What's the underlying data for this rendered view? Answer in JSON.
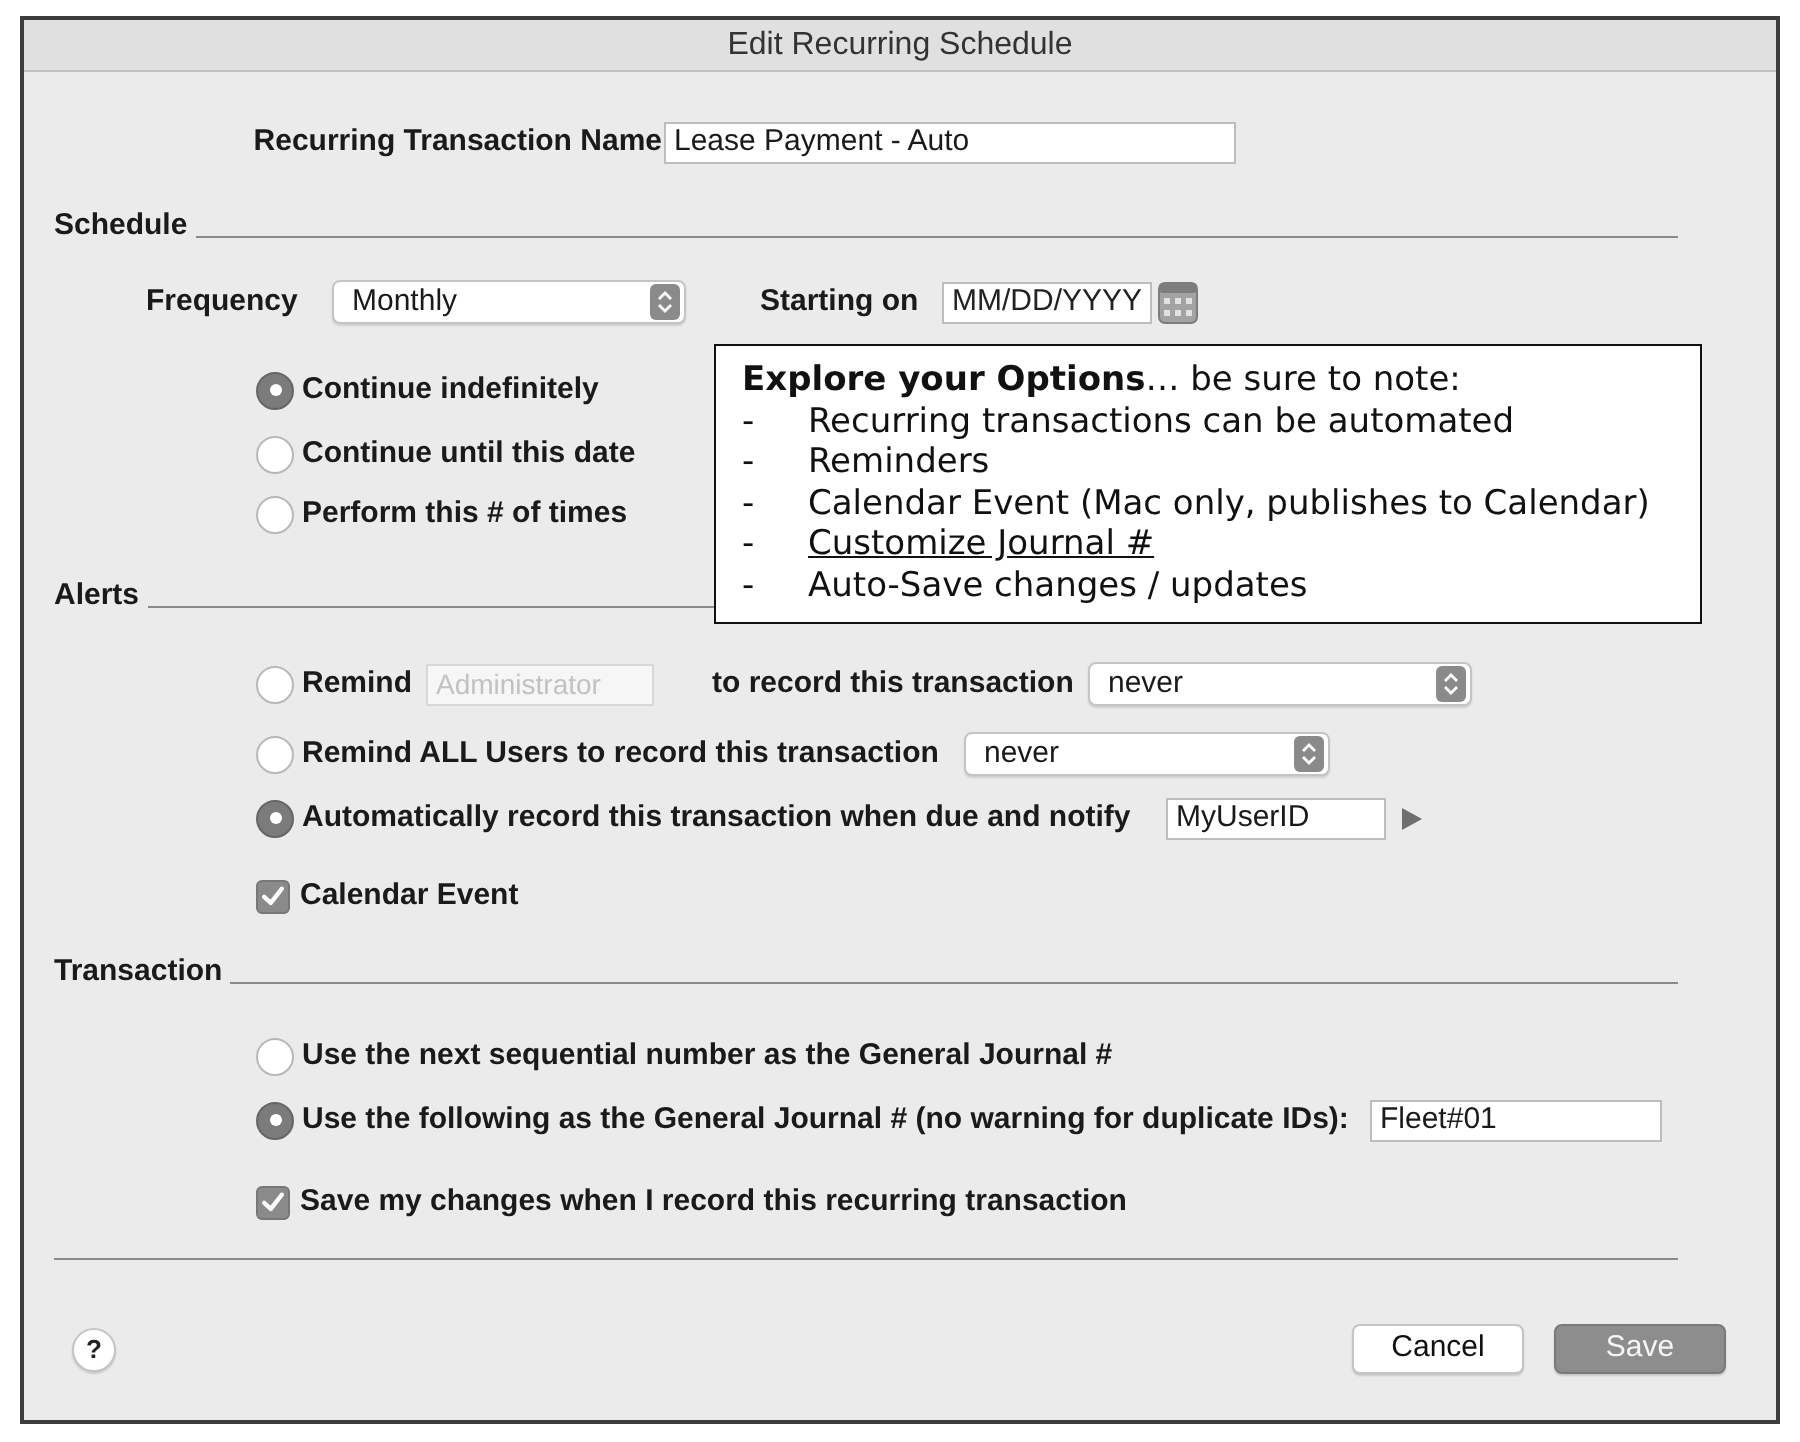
{
  "window": {
    "title": "Edit Recurring Schedule"
  },
  "name": {
    "label": "Recurring Transaction Name",
    "value": "Lease Payment - Auto"
  },
  "schedule": {
    "heading": "Schedule",
    "frequency": {
      "label": "Frequency",
      "value": "Monthly"
    },
    "starting_on": {
      "label": "Starting on",
      "placeholder": "MM/DD/YYYY"
    },
    "options": [
      {
        "label": "Continue indefinitely",
        "selected": true
      },
      {
        "label": "Continue until this date",
        "selected": false
      },
      {
        "label": "Perform this # of times",
        "selected": false
      }
    ]
  },
  "callout": {
    "heading": "**Explore your Options**… be sure to note:",
    "items": [
      {
        "marker": "-",
        "text": "Recurring transactions can be automated",
        "underlined": false
      },
      {
        "marker": "-",
        "text": "Reminders",
        "underlined": false
      },
      {
        "marker": "-",
        "text": "Calendar Event (Mac only, publishes to Calendar)",
        "underlined": false
      },
      {
        "marker": "-",
        "text": "Customize Journal #",
        "underlined": true
      },
      {
        "marker": "-",
        "text": "Auto-Save changes / updates",
        "underlined": false
      }
    ]
  },
  "alerts": {
    "heading": "Alerts",
    "options": [
      {
        "kind": "remind_user",
        "selected": false,
        "label": "Remind",
        "user": {
          "value": "Administrator",
          "disabled": true
        },
        "suffix": "to record this transaction",
        "when": "never"
      },
      {
        "kind": "remind_all",
        "selected": false,
        "label": "Remind ALL Users to record this transaction",
        "when": "never"
      },
      {
        "kind": "auto_record",
        "selected": true,
        "label": "Automatically record this transaction when due and notify",
        "notify": "MyUserID"
      }
    ],
    "calendar_event": {
      "label": "Calendar Event",
      "checked": true
    }
  },
  "transaction": {
    "heading": "Transaction",
    "options": [
      {
        "kind": "sequential",
        "selected": false,
        "label": "Use the next sequential number as the General Journal #"
      },
      {
        "kind": "custom",
        "selected": true,
        "label": "Use the following as the General Journal # (no warning for duplicate IDs):",
        "value": "Fleet#01"
      }
    ],
    "save_changes": {
      "label": "Save my changes when I record this recurring transaction",
      "checked": true
    }
  },
  "footer": {
    "help": "?",
    "buttons": [
      {
        "label": "Cancel",
        "kind": "secondary"
      },
      {
        "label": "Save",
        "kind": "default"
      }
    ]
  }
}
